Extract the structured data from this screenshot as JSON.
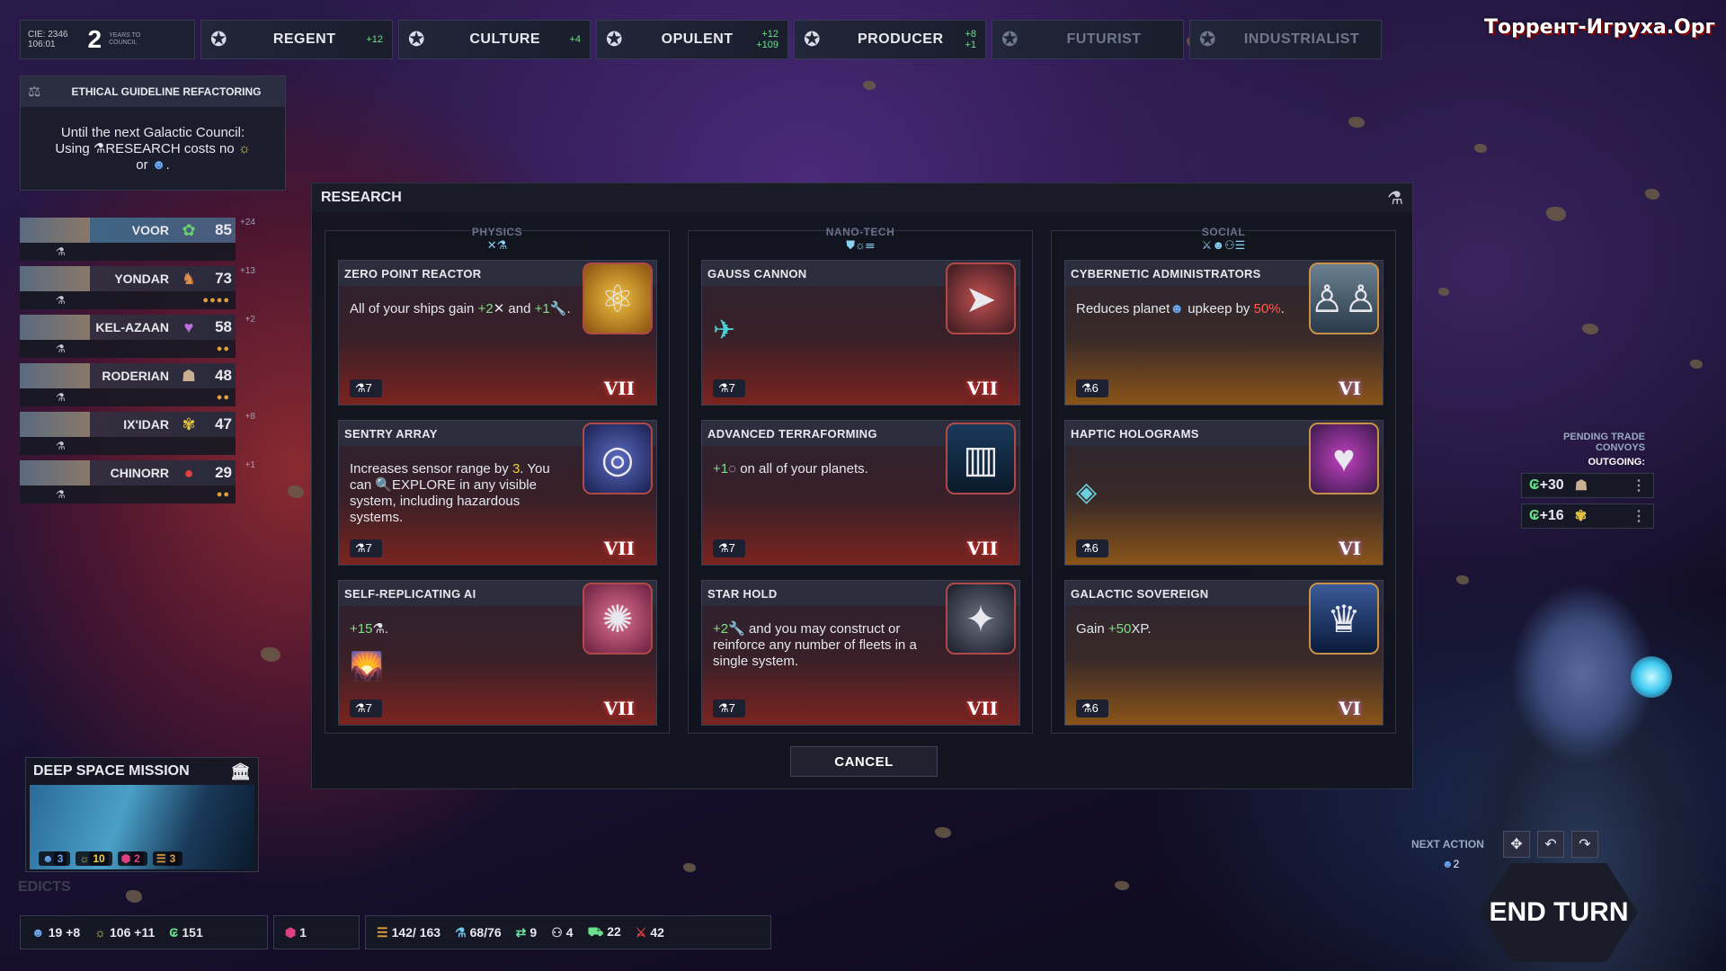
{
  "topbar": {
    "cie_label": "CIE: 2346",
    "cie_sub": "106:01",
    "years": "2",
    "years_label": "YEARS TO COUNCIL",
    "traits": [
      {
        "name": "REGENT",
        "delta": "+12"
      },
      {
        "name": "CULTURE",
        "delta": "+4"
      },
      {
        "name": "OPULENT",
        "delta": "+12",
        "delta2": "+109"
      },
      {
        "name": "PRODUCER",
        "delta": "+8",
        "delta2": "+1"
      },
      {
        "name": "FUTURIST",
        "delta": ""
      },
      {
        "name": "INDUSTRIALIST",
        "delta": ""
      }
    ]
  },
  "watermark": "Торрент-Игруха.Орг",
  "guideline": {
    "title": "ETHICAL GUIDELINE REFACTORING",
    "body_1": "Until the next Galactic Council:",
    "body_2": "Using",
    "body_research": "RESEARCH",
    "body_3": "costs no",
    "body_4": "or"
  },
  "empires": [
    {
      "name": "VOOR",
      "score": "85",
      "delta": "+24"
    },
    {
      "name": "YONDAR",
      "score": "73",
      "delta": "+13"
    },
    {
      "name": "KEL-AZAAN",
      "score": "58",
      "delta": "+2"
    },
    {
      "name": "RODERIAN",
      "score": "48",
      "delta": ""
    },
    {
      "name": "IX'IDAR",
      "score": "47",
      "delta": "+8"
    },
    {
      "name": "CHINORR",
      "score": "29",
      "delta": "+1"
    }
  ],
  "research": {
    "title": "RESEARCH",
    "cancel": "CANCEL",
    "columns": [
      {
        "label": "PHYSICS"
      },
      {
        "label": "NANO-TECH"
      },
      {
        "label": "SOCIAL"
      }
    ],
    "cards": [
      {
        "title": "ZERO POINT REACTOR",
        "desc_a": "All of your ships gain ",
        "desc_hl": "+2",
        "desc_b": " and ",
        "desc_hl2": "+1",
        "desc_c": ".",
        "cost": "7",
        "tier": "VII"
      },
      {
        "title": "SENTRY ARRAY",
        "desc_a": "Increases sensor range by ",
        "desc_hl": "3",
        "desc_b": ". You can ",
        "desc_hl2": "EXPLORE",
        "desc_c": " in any visible system, including hazardous systems.",
        "cost": "7",
        "tier": "VII"
      },
      {
        "title": "SELF-REPLICATING AI",
        "desc_a": "",
        "desc_hl": "+15",
        "desc_b": ".",
        "desc_hl2": "",
        "desc_c": "",
        "cost": "7",
        "tier": "VII"
      },
      {
        "title": "GAUSS CANNON",
        "desc_a": "",
        "desc_hl": "",
        "desc_b": "",
        "desc_hl2": "",
        "desc_c": "",
        "cost": "7",
        "tier": "VII"
      },
      {
        "title": "ADVANCED TERRAFORMING",
        "desc_a": "",
        "desc_hl": "+1",
        "desc_b": " on all of your planets.",
        "desc_hl2": "",
        "desc_c": "",
        "cost": "7",
        "tier": "VII"
      },
      {
        "title": "STAR HOLD",
        "desc_a": "",
        "desc_hl": "+2",
        "desc_b": " and you may construct or reinforce any number of fleets in a single system.",
        "desc_hl2": "",
        "desc_c": "",
        "cost": "7",
        "tier": "VII"
      },
      {
        "title": "CYBERNETIC ADMINISTRATORS",
        "desc_a": "Reduces planet",
        "desc_hl": "",
        "desc_b": " upkeep by ",
        "desc_hl2": "50%",
        "desc_c": ".",
        "cost": "6",
        "tier": "VI"
      },
      {
        "title": "HAPTIC HOLOGRAMS",
        "desc_a": "",
        "desc_hl": "",
        "desc_b": "",
        "desc_hl2": "",
        "desc_c": "",
        "cost": "6",
        "tier": "VI"
      },
      {
        "title": "GALACTIC SOVEREIGN",
        "desc_a": "Gain ",
        "desc_hl": "+50",
        "desc_b": "XP.",
        "desc_hl2": "",
        "desc_c": "",
        "cost": "6",
        "tier": "VI"
      }
    ]
  },
  "mission": {
    "title": "DEEP SPACE MISSION",
    "badge_1": "3",
    "badge_2": "10",
    "badge_3": "2",
    "badge_4": "3"
  },
  "edicts": "EDICTS",
  "bottombar": {
    "pop": "19 +8",
    "influence": "106 +11",
    "credits": "151",
    "special": "1",
    "production": "142/ 163",
    "research": "68/76",
    "trade": "9",
    "military": "4",
    "supply": "22",
    "weapons": "42"
  },
  "trade": {
    "title": "PENDING TRADE CONVOYS",
    "outgoing": "OUTGOING:",
    "rows": [
      {
        "value": "+30"
      },
      {
        "value": "+16"
      }
    ]
  },
  "actions": {
    "next_action": "NEXT ACTION",
    "count": "2",
    "end_turn": "END TURN"
  }
}
